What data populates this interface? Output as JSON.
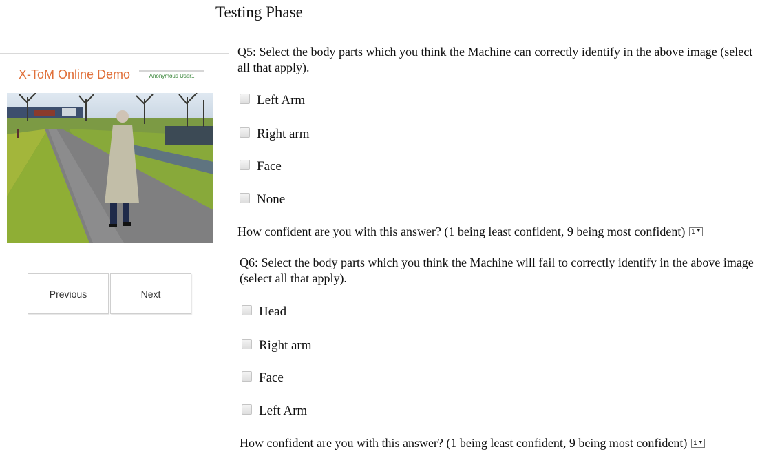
{
  "page_title": "Testing Phase",
  "sidebar": {
    "brand": "X-ToM Online Demo",
    "user": "Anonymous User1",
    "previous_label": "Previous",
    "next_label": "Next"
  },
  "q5": {
    "text": "Q5: Select the body parts which you think the Machine can correctly identify in the above image (select all that apply).",
    "options": [
      "Left Arm",
      "Right arm",
      "Face",
      "None"
    ],
    "confidence_text": "How confident are you with this answer? (1 being least confident, 9 being most confident)",
    "confidence_value": "1",
    "dropdown_icon": "chevron-down-icon"
  },
  "q6": {
    "text": "Q6: Select the body parts which you think the Machine will fail to correctly identify in the above image (select all that apply).",
    "options": [
      "Head",
      "Right arm",
      "Face",
      "Left Arm"
    ],
    "confidence_text": "How confident are you with this answer? (1 being least confident, 9 being most confident)",
    "confidence_value": "1",
    "dropdown_icon": "chevron-down-icon"
  },
  "colors": {
    "brand": "#e0703a",
    "user_badge": "#2f7f2f"
  }
}
